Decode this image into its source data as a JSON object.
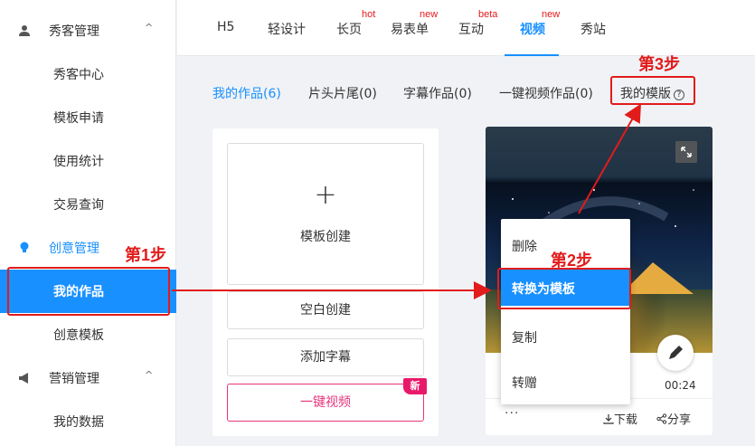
{
  "sidebar": {
    "groups": [
      {
        "label": "秀客管理",
        "caret": "^",
        "items": [
          "秀客中心",
          "模板申请",
          "使用统计",
          "交易查询"
        ]
      },
      {
        "label": "创意管理",
        "items": [
          "我的作品",
          "创意模板"
        ]
      },
      {
        "label": "营销管理",
        "caret": "^",
        "items": [
          "我的数据"
        ]
      }
    ]
  },
  "top_tabs": [
    "H5",
    "轻设计",
    "长页",
    "易表单",
    "互动",
    "视频",
    "秀站"
  ],
  "badges": {
    "changye": "hot",
    "yibiaodan": "new",
    "hudong": "beta",
    "shipin": "new"
  },
  "sub_tabs": [
    "我的作品(6)",
    "片头片尾(0)",
    "字幕作品(0)",
    "一键视频作品(0)",
    "我的模版"
  ],
  "left_card": {
    "plus": "+",
    "template_create": "模板创建",
    "blank_create": "空白创建",
    "add_subtitle": "添加字幕",
    "one_click_video": "一键视频",
    "new_tag": "新"
  },
  "video_card": {
    "duration": "00:24",
    "more": "···",
    "download": "下载",
    "share": "分享"
  },
  "dropdown": [
    "删除",
    "转换为模板",
    "复制",
    "转赠"
  ],
  "steps": [
    "第1步",
    "第2步",
    "第3步"
  ],
  "help_icon": "?",
  "colors": {
    "accent": "#1890ff",
    "annotation": "#e21b1b",
    "badge": "#e8191c",
    "pink": "#e6357b"
  }
}
